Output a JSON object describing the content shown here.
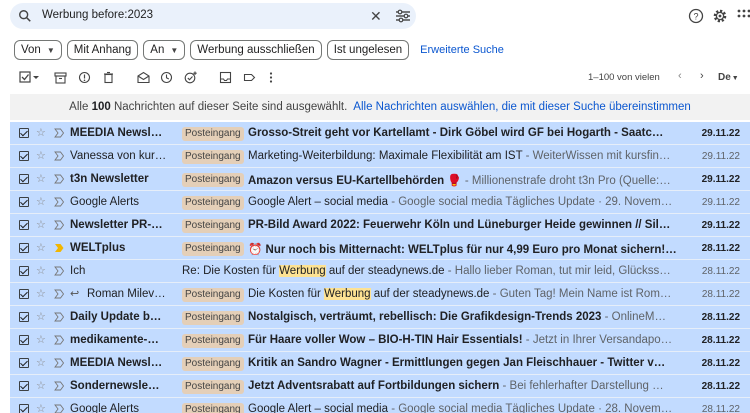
{
  "search": {
    "query": "Werbung before:2023"
  },
  "chips": {
    "from": "Von",
    "has_attachment": "Mit Anhang",
    "to": "An",
    "exclude_ads": "Werbung ausschließen",
    "unread": "Ist ungelesen",
    "advanced": "Erweiterte Suche"
  },
  "pager": {
    "range": "1–100 von vielen",
    "lang": "De"
  },
  "banner": {
    "prefix": "Alle",
    "count": "100",
    "suffix": "Nachrichten auf dieser Seite sind ausgewählt.",
    "link": "Alle Nachrichten auswählen, die mit dieser Suche übereinstimmen"
  },
  "label_inbox": "Posteingang",
  "emails": [
    {
      "sender": "MEEDIA Newsl…",
      "subject": "Grosso-Streit geht vor Kartellamt - Dirk Göbel wird GF bei Hogarth - Saatc…",
      "snippet": "",
      "date": "29.11.22",
      "unread": true,
      "label": true
    },
    {
      "sender": "Vanessa von kur…",
      "subject": "Marketing-Weiterbildung: Maximale Flexibilität am IST",
      "snippet": " - WeiterWissen mit kursfin…",
      "date": "29.11.22",
      "unread": false,
      "label": true
    },
    {
      "sender": "t3n Newsletter",
      "subject": "Amazon versus EU-Kartellbehörden 🥊",
      "snippet": " - Millionenstrafe droht t3n Pro (Quelle:…",
      "date": "29.11.22",
      "unread": true,
      "label": true
    },
    {
      "sender": "Google Alerts",
      "subject": "Google Alert – social media",
      "snippet": " - Google social media Tägliches Update · 29. Novem…",
      "date": "29.11.22",
      "unread": false,
      "label": true
    },
    {
      "sender": "Newsletter PR-…",
      "subject": "PR-Bild Award 2022: Feuerwehr Köln und Lüneburger Heide gewinnen // Sil…",
      "snippet": "",
      "date": "29.11.22",
      "unread": true,
      "label": true
    },
    {
      "sender": "WELTplus",
      "subject": "⏰ Nur noch bis Mitternacht: WELTplus für nur 4,99 Euro pro Monat sichern!…",
      "snippet": "",
      "date": "28.11.22",
      "unread": true,
      "label": true
    },
    {
      "sender": "Ich",
      "subject_pre": "Re: Die Kosten für ",
      "highlight": "Werbung",
      "subject_post": " auf der steadynews.de",
      "snippet": " - Hallo lieber Roman, tut mir leid, Glückss…",
      "date": "28.11.22",
      "unread": false,
      "label": false
    },
    {
      "sender": "Roman Milev…",
      "reply": true,
      "subject_pre": "Die Kosten für ",
      "highlight": "Werbung",
      "subject_post": " auf der steadynews.de",
      "snippet": " - Guten Tag! Mein Name ist Rom…",
      "date": "28.11.22",
      "unread": false,
      "label": true
    },
    {
      "sender": "Daily Update b…",
      "subject": "Nostalgisch, verträumt, rebellisch: Die Grafikdesign-Trends 2023",
      "snippet": " - OnlineM…",
      "date": "28.11.22",
      "unread": true,
      "label": true
    },
    {
      "sender": "medikamente-…",
      "subject": "Für Haare voller Wow – BIO-H-TIN Hair Essentials!",
      "snippet": " - Jetzt in Ihrer Versandapo…",
      "date": "28.11.22",
      "unread": true,
      "label": true
    },
    {
      "sender": "MEEDIA Newsl…",
      "subject": "Kritik an Sandro Wagner - Ermittlungen gegen Jan Fleischhauer - Twitter v…",
      "snippet": "",
      "date": "28.11.22",
      "unread": true,
      "label": true
    },
    {
      "sender": "Sondernewsle…",
      "subject": "Jetzt Adventsrabatt auf Fortbildungen sichern",
      "snippet": " - Bei fehlerhafter Darstellung …",
      "date": "28.11.22",
      "unread": true,
      "label": true
    },
    {
      "sender": "Google Alerts",
      "subject": "Google Alert – social media",
      "snippet": " - Google social media Tägliches Update · 28. Novem…",
      "date": "28.11.22",
      "unread": false,
      "label": true
    }
  ],
  "colors": {
    "selected_row": "#c2dbff",
    "label_bg": "#e4cfb8",
    "highlight": "#fde293",
    "important_marker": "#f2b600",
    "link": "#0b57d0"
  }
}
